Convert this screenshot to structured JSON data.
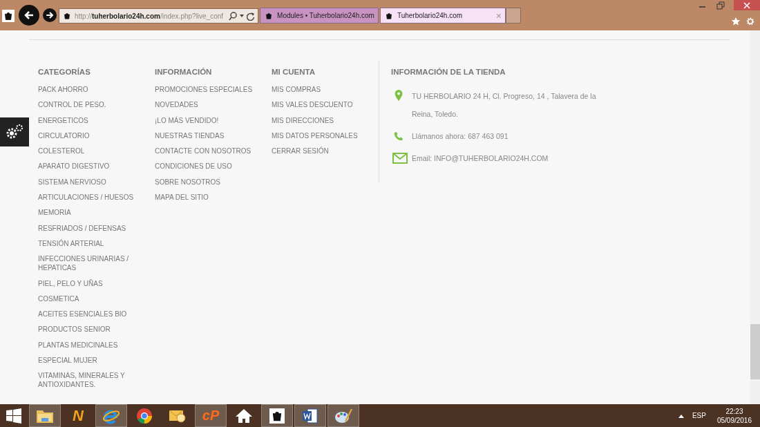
{
  "browser": {
    "address": "http://**tuherbolario24h.com**/index.php?live_conf",
    "tabs": [
      {
        "title": "Modules • Tuherbolario24h.com",
        "selected": false
      },
      {
        "title": "Tuherbolario24h.com",
        "selected": true,
        "close": "×"
      }
    ]
  },
  "footer": {
    "columns": [
      {
        "heading": "CATEGORÍAS",
        "items": [
          "PACK AHORRO",
          "CONTROL DE PESO.",
          "ENERGETICOS",
          "CIRCULATORIO",
          "COLESTEROL",
          "APARATO DIGESTIVO",
          "SISTEMA NERVIOSO",
          "ARTICULACIONES / HUESOS",
          "MEMORIA",
          "RESFRIADOS / DEFENSAS",
          "TENSIÓN ARTERIAL",
          "INFECCIONES URINARIAS / HEPATICAS",
          "PIEL, PELO Y UÑAS",
          "COSMETICA",
          "ACEITES ESENCIALES BIO",
          "PRODUCTOS SENIOR",
          "PLANTAS MEDICINALES",
          "ESPECIAL MUJER",
          "VITAMINAS, MINERALES Y ANTIOXIDANTES."
        ]
      },
      {
        "heading": "INFORMACIÓN",
        "items": [
          "PROMOCIONES ESPECIALES",
          "NOVEDADES",
          "¡LO MÁS VENDIDO!",
          "NUESTRAS TIENDAS",
          "CONTACTE CON NOSOTROS",
          "CONDICIONES DE USO",
          "SOBRE NOSOTROS",
          "MAPA DEL SITIO"
        ]
      },
      {
        "heading": "MI CUENTA",
        "items": [
          "MIS COMPRAS",
          "MIS VALES DESCUENTO",
          "MIS DIRECCIONES",
          "MIS DATOS PERSONALES",
          "CERRAR SESIÓN"
        ]
      }
    ],
    "store": {
      "heading": "INFORMACIÓN DE LA TIENDA",
      "lines": [
        {
          "kind": "address",
          "text": "TU HERBOLARIO 24 H, Cl. Progreso, 14 , Talavera de la Reina, Toledo."
        },
        {
          "kind": "phone",
          "text": "Llámanos ahora: 687 463 091"
        },
        {
          "kind": "email",
          "text": "Email: INFO@TUHERBOLARIO24H.COM"
        }
      ]
    }
  },
  "taskbar": {
    "items": [
      {
        "kind": "folder",
        "running": true
      },
      {
        "kind": "letter",
        "label": "N",
        "running": false
      },
      {
        "kind": "ie",
        "running": true
      },
      {
        "kind": "chrome",
        "running": false
      },
      {
        "kind": "mail",
        "running": false
      },
      {
        "kind": "letter2",
        "label": "cP",
        "running": true
      },
      {
        "kind": "home",
        "running": false
      },
      {
        "kind": "shop",
        "running": true
      },
      {
        "kind": "word",
        "running": true
      },
      {
        "kind": "paint",
        "running": true
      }
    ],
    "language": "ESP",
    "time": "22:23",
    "date": "05/09/2016"
  }
}
